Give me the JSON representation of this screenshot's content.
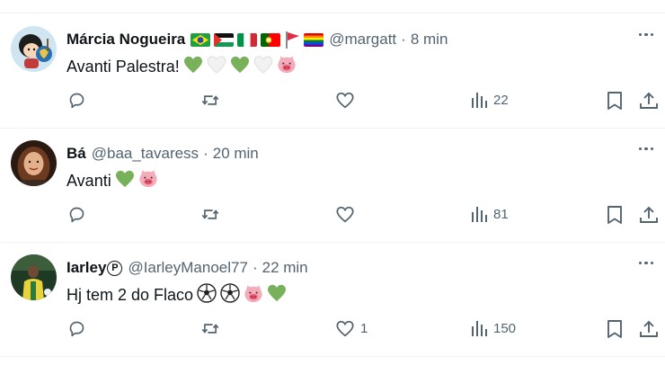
{
  "tweets": [
    {
      "name": "Márcia Nogueira",
      "handle": "@margatt",
      "separator": "·",
      "time": "8 min",
      "flags": [
        "brazil-flag",
        "palestine-flag",
        "italy-flag",
        "portugal-flag",
        "red-pennant-flag",
        "rainbow-flag"
      ],
      "text": "Avanti Palestra!",
      "emojis": [
        "green-heart",
        "white-heart",
        "green-heart",
        "white-heart",
        "pig-face"
      ],
      "likes": "",
      "views": "22"
    },
    {
      "name": "Bá",
      "handle": "@baa_tavaress",
      "separator": "·",
      "time": "20 min",
      "text": "Avanti",
      "emojis": [
        "green-heart",
        "pig-face"
      ],
      "likes": "",
      "views": "81"
    },
    {
      "name": "Iarley",
      "name_badge": "P",
      "handle": "@IarleyManoel77",
      "separator": "·",
      "time": "22 min",
      "text": "Hj tem 2 do Flaco",
      "emojis": [
        "soccer-ball",
        "soccer-ball",
        "pig-face",
        "green-heart"
      ],
      "likes": "1",
      "views": "150"
    }
  ],
  "colors": {
    "secondary_text": "#536471",
    "divider": "#eff3f4",
    "green_heart": "#78b159"
  }
}
